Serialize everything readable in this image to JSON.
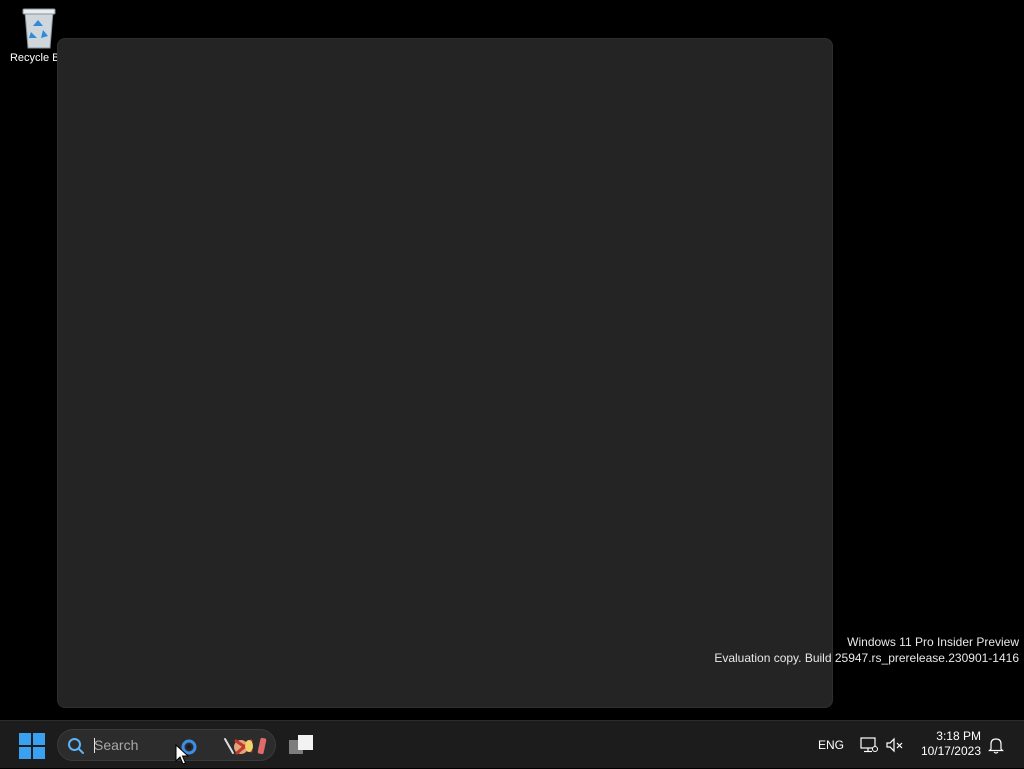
{
  "desktop": {
    "icons": [
      {
        "label": "Recycle Bin",
        "icon": "recycle-bin-icon"
      }
    ]
  },
  "watermark": {
    "line1": "Windows 11 Pro Insider Preview",
    "line2": "Evaluation copy. Build 25947.rs_prerelease.230901-1416"
  },
  "taskbar": {
    "start_icon": "windows-logo-icon",
    "search": {
      "placeholder": "Search",
      "value": ""
    },
    "task_view_icon": "task-view-icon",
    "tray": {
      "language": "ENG",
      "time": "3:18 PM",
      "date": "10/17/2023"
    }
  },
  "colors": {
    "desktop_bg": "#000000",
    "panel_bg": "#242424",
    "taskbar_bg": "#1c1c1c",
    "accent": "#3aa0f0"
  }
}
